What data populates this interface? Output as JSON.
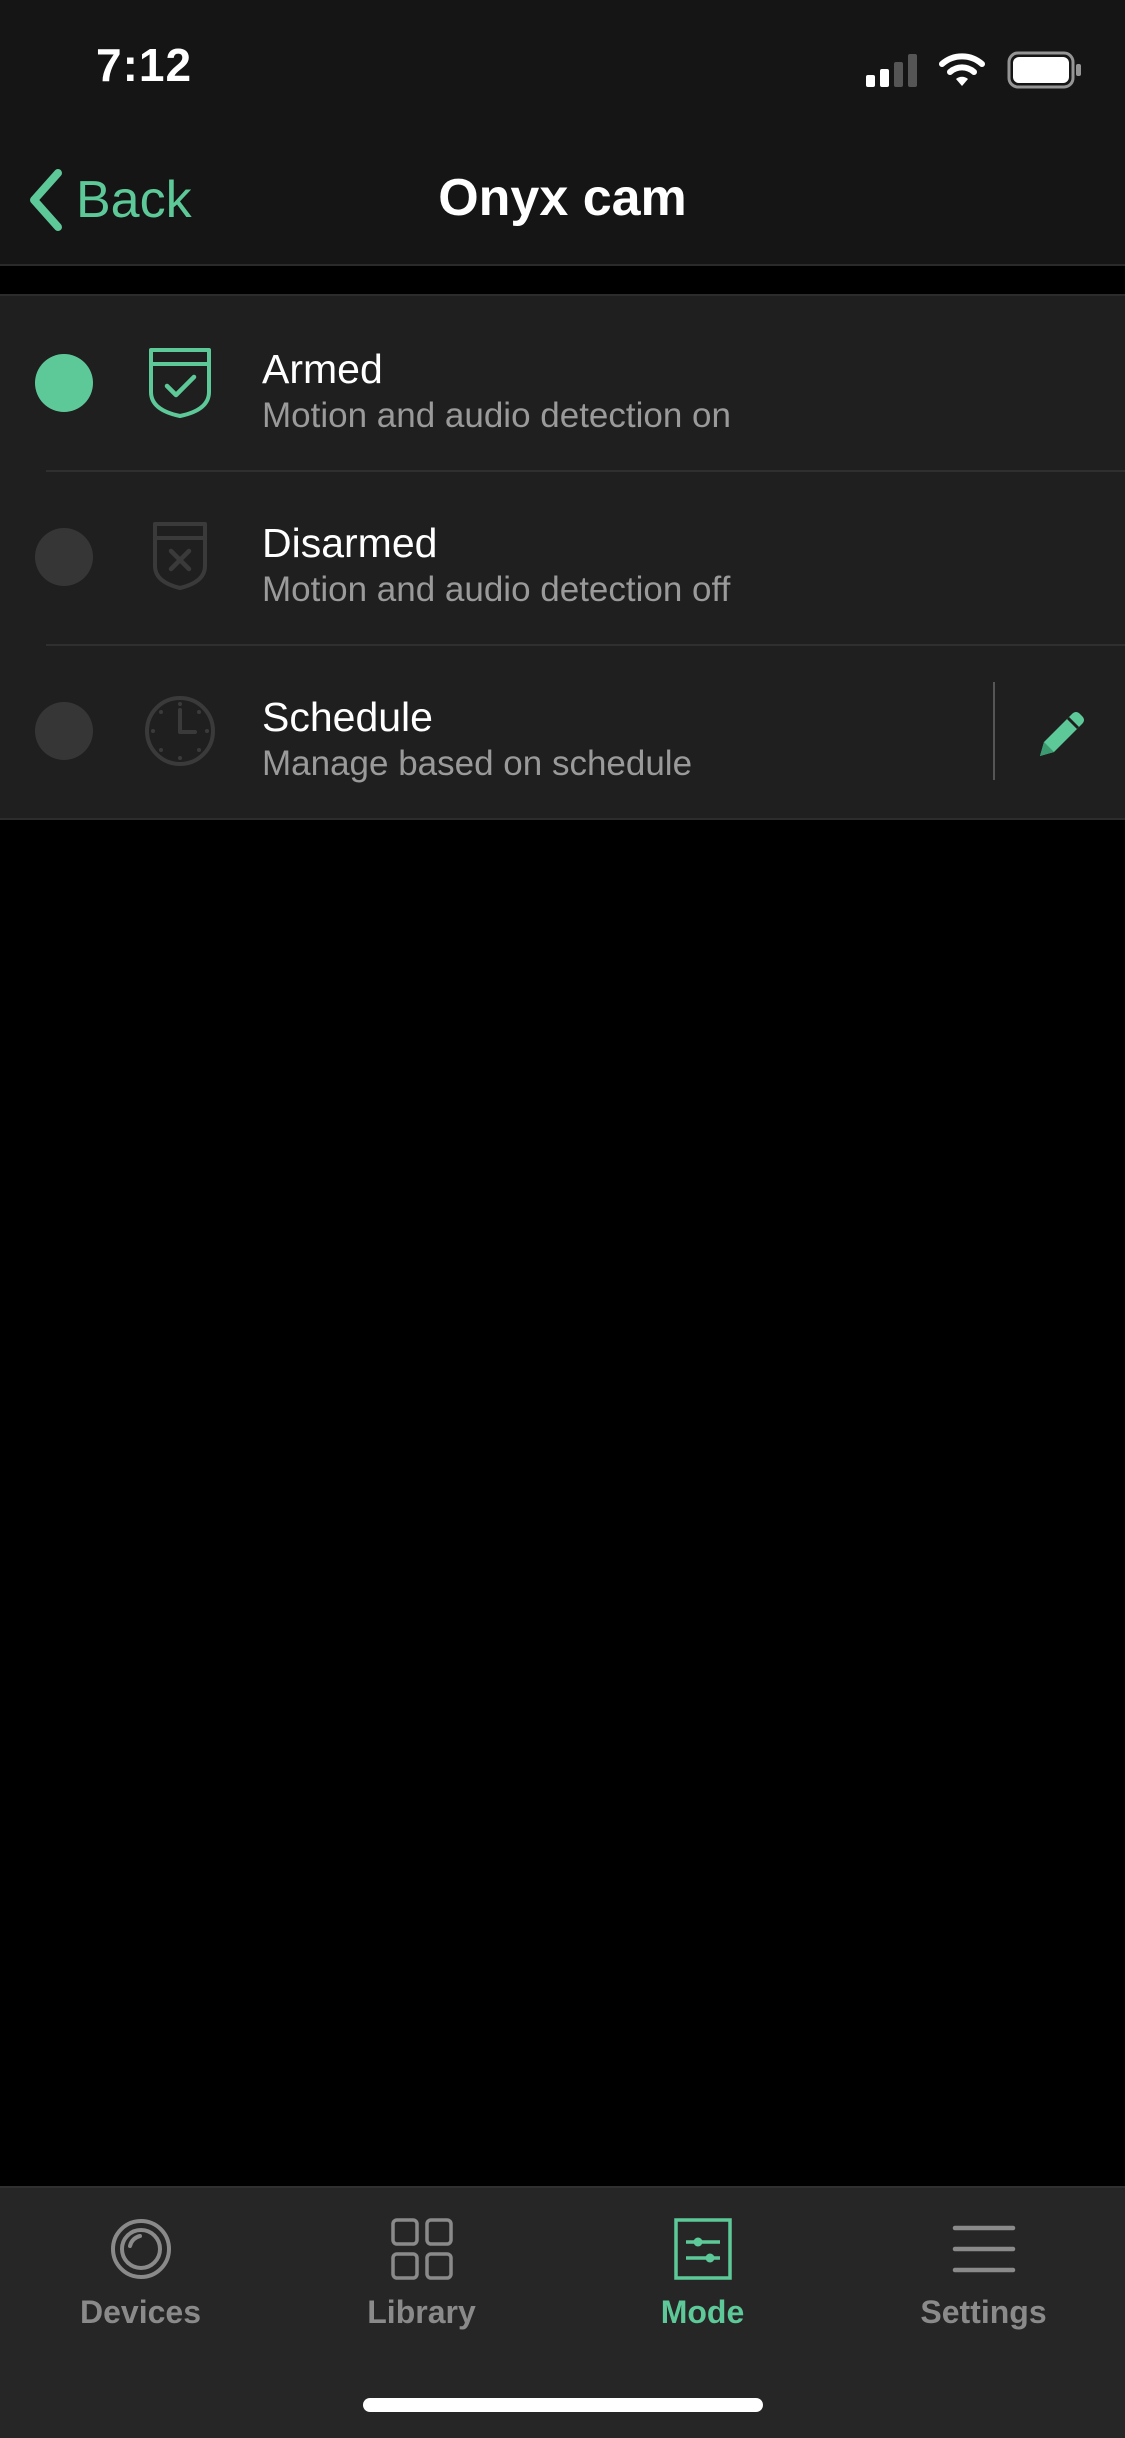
{
  "status_bar": {
    "time": "7:12",
    "signal_icon": "cellular-signal-icon",
    "wifi_icon": "wifi-icon",
    "battery_icon": "battery-icon"
  },
  "nav": {
    "back_label": "Back",
    "back_icon": "chevron-left-icon",
    "title": "Onyx cam"
  },
  "modes": [
    {
      "title": "Armed",
      "subtitle": "Motion and audio detection on",
      "icon": "shield-check-icon",
      "selected": true
    },
    {
      "title": "Disarmed",
      "subtitle": "Motion and audio detection off",
      "icon": "shield-x-icon",
      "selected": false
    },
    {
      "title": "Schedule",
      "subtitle": "Manage based on schedule",
      "icon": "clock-icon",
      "selected": false,
      "edit_icon": "pencil-icon"
    }
  ],
  "tabs": [
    {
      "label": "Devices",
      "icon": "camera-lens-icon",
      "active": false
    },
    {
      "label": "Library",
      "icon": "grid-icon",
      "active": false
    },
    {
      "label": "Mode",
      "icon": "sliders-icon",
      "active": true
    },
    {
      "label": "Settings",
      "icon": "menu-icon",
      "active": false
    }
  ],
  "colors": {
    "accent": "#5ec998",
    "background": "#000000",
    "header_background": "#151515",
    "row_background": "#1f1f1f",
    "tabbar_background": "#262626",
    "inactive": "#8a8a8a"
  }
}
